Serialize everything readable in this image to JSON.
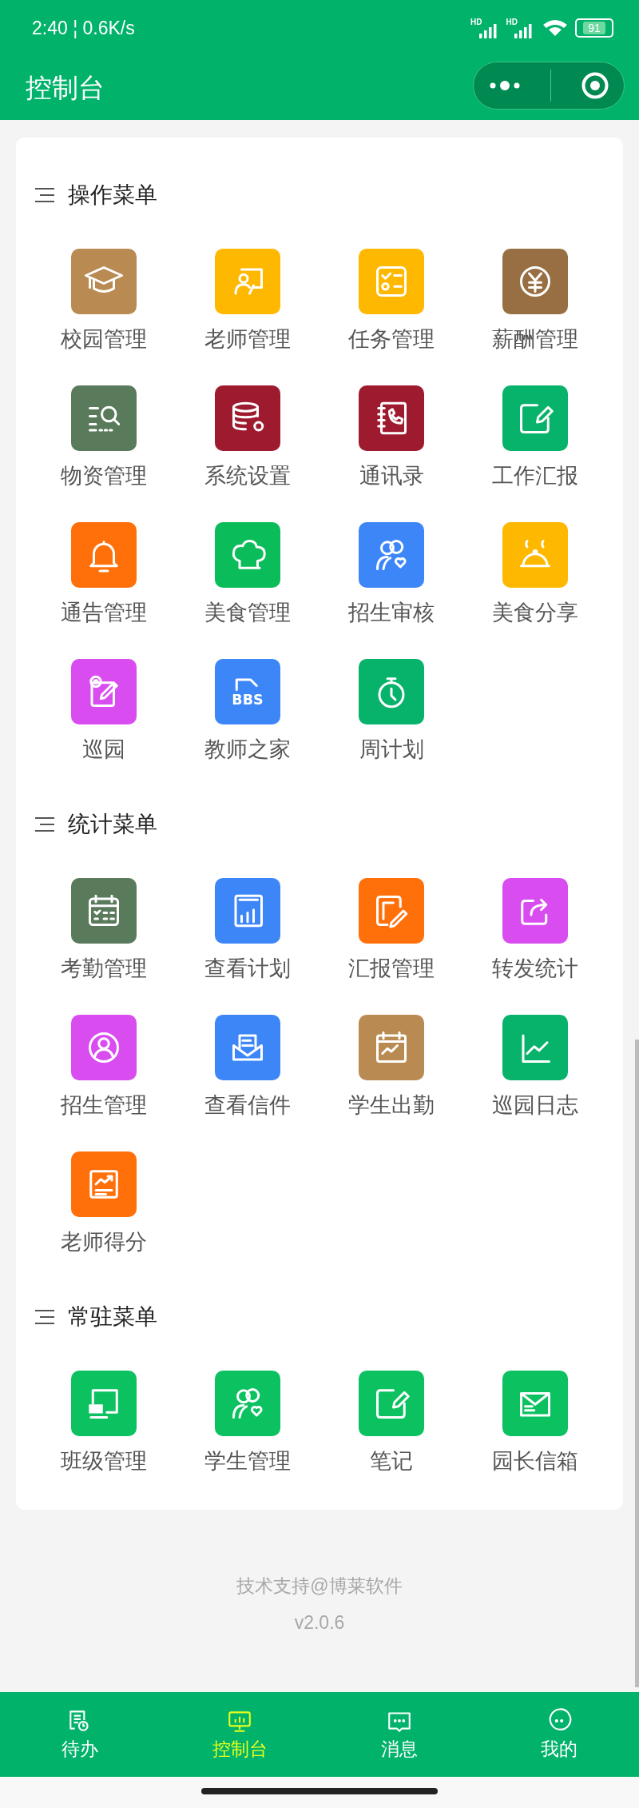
{
  "status_bar": {
    "time_speed": "2:40 ¦ 0.6K/s",
    "signals": [
      "HD",
      "HD"
    ],
    "battery": "91"
  },
  "header": {
    "title": "控制台"
  },
  "sections": [
    {
      "title": "操作菜单",
      "items": [
        {
          "label": "校园管理",
          "color": "#b98a52"
        },
        {
          "label": "老师管理",
          "color": "#ffb800"
        },
        {
          "label": "任务管理",
          "color": "#ffb800"
        },
        {
          "label": "薪酬管理",
          "color": "#986f43"
        },
        {
          "label": "物资管理",
          "color": "#5a7a5c"
        },
        {
          "label": "系统设置",
          "color": "#9e1a2e"
        },
        {
          "label": "通讯录",
          "color": "#9e1a2e"
        },
        {
          "label": "工作汇报",
          "color": "#07b26a"
        },
        {
          "label": "通告管理",
          "color": "#ff700a"
        },
        {
          "label": "美食管理",
          "color": "#0bbd5a"
        },
        {
          "label": "招生审核",
          "color": "#3d86f8"
        },
        {
          "label": "美食分享",
          "color": "#ffb800"
        },
        {
          "label": "巡园",
          "color": "#d84cf0"
        },
        {
          "label": "教师之家",
          "color": "#3d86f8",
          "icon_text": "BBS"
        },
        {
          "label": "周计划",
          "color": "#07b26a"
        }
      ]
    },
    {
      "title": "统计菜单",
      "items": [
        {
          "label": "考勤管理",
          "color": "#5a7a5c"
        },
        {
          "label": "查看计划",
          "color": "#3d86f8"
        },
        {
          "label": "汇报管理",
          "color": "#ff700a"
        },
        {
          "label": "转发统计",
          "color": "#d84cf0"
        },
        {
          "label": "招生管理",
          "color": "#d84cf0"
        },
        {
          "label": "查看信件",
          "color": "#3d86f8"
        },
        {
          "label": "学生出勤",
          "color": "#b98a52"
        },
        {
          "label": "巡园日志",
          "color": "#07b26a"
        },
        {
          "label": "老师得分",
          "color": "#ff700a"
        }
      ]
    },
    {
      "title": "常驻菜单",
      "items": [
        {
          "label": "班级管理",
          "color": "#0bc160"
        },
        {
          "label": "学生管理",
          "color": "#0bc160"
        },
        {
          "label": "笔记",
          "color": "#0bc160"
        },
        {
          "label": "园长信箱",
          "color": "#0bc160"
        }
      ]
    }
  ],
  "footer": {
    "support": "技术支持@博莱软件",
    "version": "v2.0.6"
  },
  "tabs": [
    {
      "label": "待办",
      "selected": false
    },
    {
      "label": "控制台",
      "selected": true
    },
    {
      "label": "消息",
      "selected": false
    },
    {
      "label": "我的",
      "selected": false
    }
  ]
}
